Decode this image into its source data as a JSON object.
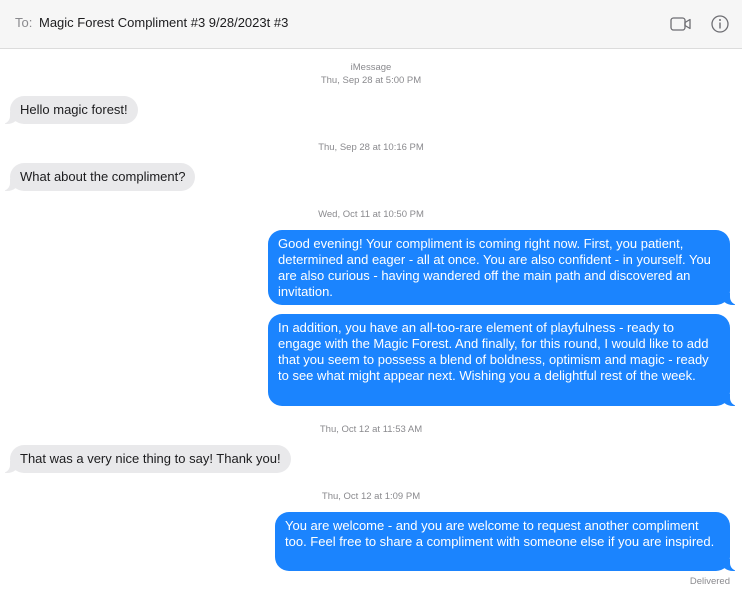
{
  "header": {
    "to_label": "To:",
    "recipient": "Magic Forest Compliment #3 9/28/2023t #3",
    "video_icon": "video-camera-icon",
    "info_icon": "info-circle-icon"
  },
  "service": "iMessage",
  "transcript": [
    {
      "type": "timestamp",
      "text": "Thu, Sep 28 at 5:00 PM"
    },
    {
      "type": "message",
      "direction": "incoming",
      "text": "Hello magic forest!"
    },
    {
      "type": "timestamp",
      "text": "Thu, Sep 28 at 10:16 PM"
    },
    {
      "type": "message",
      "direction": "incoming",
      "text": "What about the compliment?"
    },
    {
      "type": "timestamp",
      "text": "Wed, Oct 11 at 10:50 PM"
    },
    {
      "type": "message",
      "direction": "outgoing",
      "text": "Good evening! Your compliment is coming right now. First, you patient, determined and eager - all at once. You are also confident - in yourself. You are also curious - having wandered off the main path and discovered an invitation."
    },
    {
      "type": "message",
      "direction": "outgoing",
      "text": "In addition, you have an all-too-rare element of playfulness - ready to engage with the Magic Forest. And finally, for this round, I would like to add that you seem to possess a blend of boldness, optimism and magic - ready to see what might appear next. Wishing you a delightful rest of the week."
    },
    {
      "type": "timestamp",
      "text": "Thu, Oct 12 at 11:53 AM"
    },
    {
      "type": "message",
      "direction": "incoming",
      "text": "That was a very nice thing to say! Thank you!"
    },
    {
      "type": "timestamp",
      "text": "Thu, Oct 12 at 1:09 PM"
    },
    {
      "type": "message",
      "direction": "outgoing",
      "text": "You are welcome - and you are welcome to request another compliment too. Feel free to share a compliment with someone else if you are inspired."
    }
  ],
  "status": "Delivered",
  "colors": {
    "outgoing_bubble": "#1b84fe",
    "incoming_bubble": "#e9e9eb",
    "header_bg": "#f6f6f6",
    "meta_text": "#8a8a8e"
  }
}
